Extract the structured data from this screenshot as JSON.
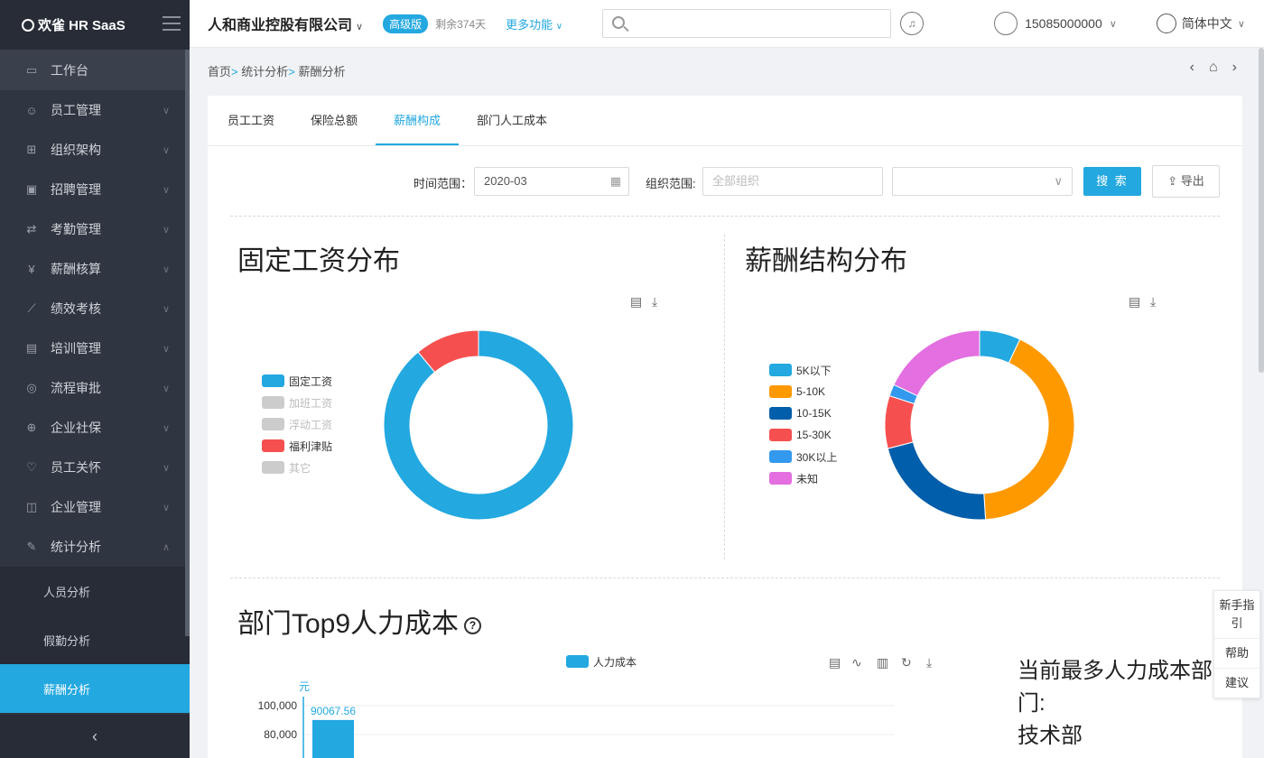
{
  "sidebar": {
    "logo": "欢雀 HR SaaS",
    "workbench": "工作台",
    "items": [
      {
        "label": "员工管理",
        "icon": "people-icon"
      },
      {
        "label": "组织架构",
        "icon": "org-icon"
      },
      {
        "label": "招聘管理",
        "icon": "recruit-icon"
      },
      {
        "label": "考勤管理",
        "icon": "attendance-icon"
      },
      {
        "label": "薪酬核算",
        "icon": "yen-icon"
      },
      {
        "label": "绩效考核",
        "icon": "chart-line-icon"
      },
      {
        "label": "培训管理",
        "icon": "clipboard-icon"
      },
      {
        "label": "流程审批",
        "icon": "flow-icon"
      },
      {
        "label": "企业社保",
        "icon": "insurance-icon"
      },
      {
        "label": "员工关怀",
        "icon": "care-icon"
      },
      {
        "label": "企业管理",
        "icon": "lock-icon"
      },
      {
        "label": "统计分析",
        "icon": "analysis-icon"
      }
    ],
    "sub_items": [
      "人员分析",
      "假勤分析",
      "薪酬分析"
    ]
  },
  "header": {
    "company": "人和商业控股有限公司",
    "badge": "高级版",
    "remain": "剩余374天",
    "more": "更多功能",
    "search_placeholder": "",
    "phone": "15085000000",
    "language": "简体中文"
  },
  "breadcrumb": {
    "home": "首页",
    "level1": "统计分析",
    "level2": "薪酬分析"
  },
  "tabs": [
    "员工工资",
    "保险总额",
    "薪酬构成",
    "部门人工成本"
  ],
  "filters": {
    "time_label": "时间范围：",
    "time_value": "2020-03",
    "org_label": "组织范围:",
    "org_placeholder": "全部组织",
    "select_value": "",
    "search_btn": "搜 索",
    "export_btn": "导出"
  },
  "sections": {
    "fixed_title": "固定工资分布",
    "structure_title": "薪酬结构分布",
    "dept_title": "部门Top9人力成本",
    "side_label": "当前最多人力成本部门:",
    "side_value": "技术部"
  },
  "float_panel": [
    "新手指引",
    "帮助",
    "建议"
  ],
  "chart_data": [
    {
      "type": "pie",
      "title": "固定工资分布",
      "legend": [
        {
          "name": "固定工资",
          "color": "#23a8e0",
          "enabled": true
        },
        {
          "name": "加班工资",
          "color": "#cccccc",
          "enabled": false
        },
        {
          "name": "浮动工资",
          "color": "#cccccc",
          "enabled": false
        },
        {
          "name": "福利津贴",
          "color": "#f5504f",
          "enabled": true
        },
        {
          "name": "其它",
          "color": "#cccccc",
          "enabled": false
        }
      ],
      "slices": [
        {
          "name": "固定工资",
          "value": 89,
          "color": "#23a8e0"
        },
        {
          "name": "福利津贴",
          "value": 11,
          "color": "#f5504f"
        }
      ]
    },
    {
      "type": "pie",
      "title": "薪酬结构分布",
      "legend": [
        {
          "name": "5K以下",
          "color": "#23a8e0"
        },
        {
          "name": "5-10K",
          "color": "#ff9900"
        },
        {
          "name": "10-15K",
          "color": "#005eaa"
        },
        {
          "name": "15-30K",
          "color": "#f5504f"
        },
        {
          "name": "30K以上",
          "color": "#3399ee"
        },
        {
          "name": "未知",
          "color": "#e36fe0"
        }
      ],
      "slices": [
        {
          "name": "5K以下",
          "value": 7,
          "color": "#23a8e0"
        },
        {
          "name": "5-10K",
          "value": 42,
          "color": "#ff9900"
        },
        {
          "name": "10-15K",
          "value": 22,
          "color": "#005eaa"
        },
        {
          "name": "15-30K",
          "value": 9,
          "color": "#f5504f"
        },
        {
          "name": "30K以上",
          "value": 2,
          "color": "#3399ee"
        },
        {
          "name": "未知",
          "value": 18,
          "color": "#e36fe0"
        }
      ]
    },
    {
      "type": "bar",
      "title": "部门Top9人力成本",
      "legend": [
        "人力成本"
      ],
      "ylabel": "元",
      "yticks": [
        "100,000",
        "80,000"
      ],
      "ylim": [
        0,
        100000
      ],
      "values": [
        90067.56
      ],
      "data_labels": [
        "90067.56"
      ],
      "color": "#23a8e0"
    }
  ]
}
